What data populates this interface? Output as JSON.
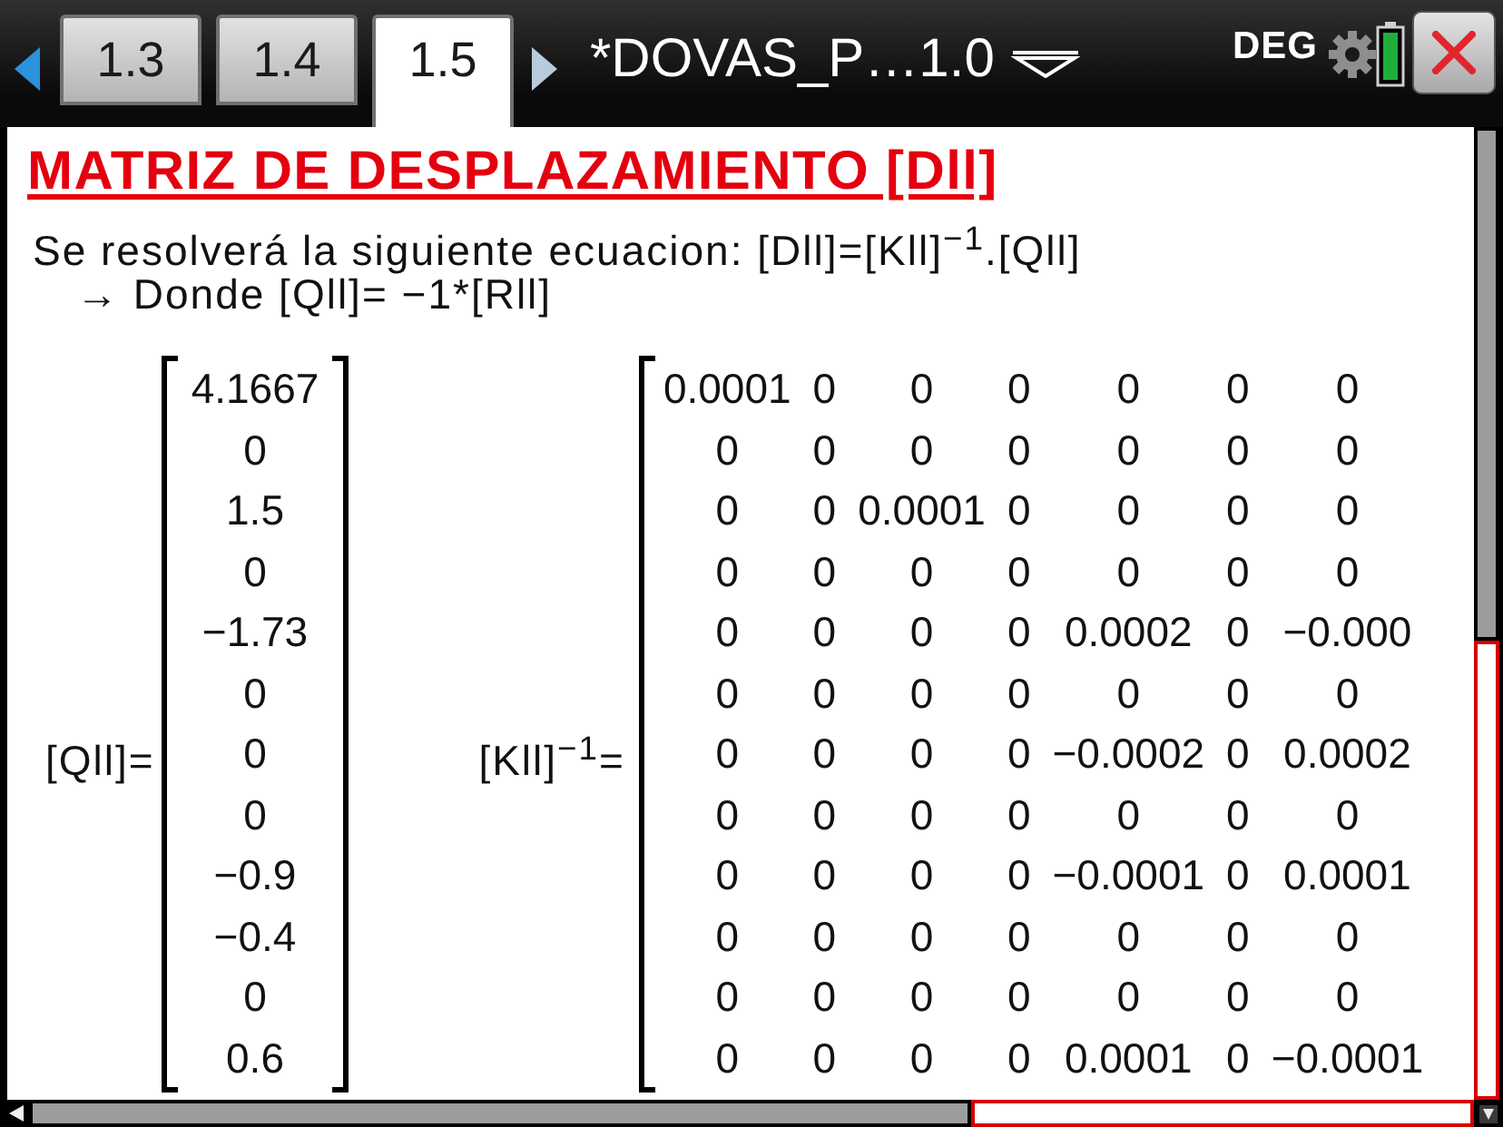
{
  "top_bar": {
    "tabs": [
      {
        "label": "1.3",
        "selected": false
      },
      {
        "label": "1.4",
        "selected": false
      },
      {
        "label": "1.5",
        "selected": true
      }
    ],
    "document_title": "*DOVAS_P…1.0",
    "angle_mode": "DEG"
  },
  "page": {
    "heading": "MATRIZ DE DESPLAZAMIENTO [Dll]",
    "equation": "Se resolverá la siguiente ecuacion: [Dll]=[Kll]$^{−1}$.[Qll]",
    "note": "→ Donde [Qll]= −1*[Rll]",
    "q_vector": {
      "label": "[Qll]=",
      "values": [
        "4.1667",
        "0",
        "1.5",
        "0",
        "−1.73",
        "0",
        "0",
        "0",
        "−0.9",
        "−0.4",
        "0",
        "0.6"
      ]
    },
    "k_inverse": {
      "label": "[Kll]$^{−1}$=",
      "rows": [
        [
          "0.0001",
          "0",
          "0",
          "0",
          "0",
          "0",
          "0"
        ],
        [
          "0",
          "0",
          "0",
          "0",
          "0",
          "0",
          "0"
        ],
        [
          "0",
          "0",
          "0.0001",
          "0",
          "0",
          "0",
          "0"
        ],
        [
          "0",
          "0",
          "0",
          "0",
          "0",
          "0",
          "0"
        ],
        [
          "0",
          "0",
          "0",
          "0",
          "0.0002",
          "0",
          "−0.000"
        ],
        [
          "0",
          "0",
          "0",
          "0",
          "0",
          "0",
          "0"
        ],
        [
          "0",
          "0",
          "0",
          "0",
          "−0.0002",
          "0",
          "0.0002"
        ],
        [
          "0",
          "0",
          "0",
          "0",
          "0",
          "0",
          "0"
        ],
        [
          "0",
          "0",
          "0",
          "0",
          "−0.0001",
          "0",
          "0.0001"
        ],
        [
          "0",
          "0",
          "0",
          "0",
          "0",
          "0",
          "0"
        ],
        [
          "0",
          "0",
          "0",
          "0",
          "0",
          "0",
          "0"
        ],
        [
          "0",
          "0",
          "0",
          "0",
          "0.0001",
          "0",
          "−0.0001"
        ]
      ]
    }
  }
}
